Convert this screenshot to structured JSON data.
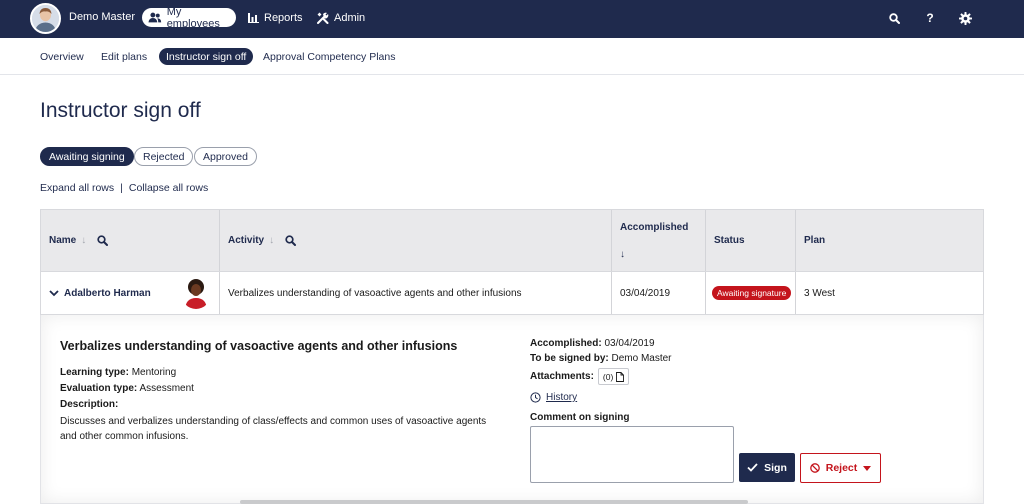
{
  "topbar": {
    "user_name": "Demo Master",
    "nav": [
      {
        "label": "My employees",
        "icon": "people-icon",
        "active": true
      },
      {
        "label": "Reports",
        "icon": "bar-chart-icon"
      },
      {
        "label": "Admin",
        "icon": "tools-icon"
      }
    ],
    "icons": [
      "search-icon",
      "help-icon",
      "gear-icon"
    ],
    "help_glyph": "?"
  },
  "subnav": {
    "items": [
      "Overview",
      "Edit plans",
      "Instructor sign off",
      "Approval Competency Plans"
    ],
    "active_index": 2
  },
  "page": {
    "title": "Instructor sign off",
    "filters": [
      {
        "label": "Awaiting signing",
        "active": true
      },
      {
        "label": "Rejected",
        "active": false
      },
      {
        "label": "Approved",
        "active": false
      }
    ],
    "expand_all": "Expand all rows",
    "separator": "|",
    "collapse_all": "Collapse all rows"
  },
  "table": {
    "columns": [
      "Name",
      "Activity",
      "Accomplished",
      "Status",
      "Plan"
    ],
    "sort_arrow": "↓",
    "rows": [
      {
        "name": "Adalberto Harman",
        "activity": "Verbalizes understanding of vasoactive agents and other infusions",
        "accomplished": "03/04/2019",
        "status": "Awaiting signature",
        "plan": "3 West"
      }
    ]
  },
  "detail": {
    "title": "Verbalizes understanding of vasoactive agents and other infusions",
    "learning_type_label": "Learning type:",
    "learning_type": "Mentoring",
    "evaluation_type_label": "Evaluation type:",
    "evaluation_type": "Assessment",
    "description_label": "Description:",
    "description": "Discusses and verbalizes understanding of class/effects and common uses of vasoactive agents and other common infusions.",
    "accomplished_label": "Accomplished",
    "accomplished": "03/04/2019",
    "signed_by_label": "To be signed by:",
    "signed_by": "Demo Master",
    "attachments_label": "Attachments:",
    "attachments_count": "(0)",
    "history_label": "History",
    "comment_label": "Comment on signing",
    "sign_label": "Sign",
    "reject_label": "Reject"
  },
  "colors": {
    "navy": "#1f2a4d",
    "status_red": "#c4141c",
    "header_gray": "#e9e9eb"
  }
}
